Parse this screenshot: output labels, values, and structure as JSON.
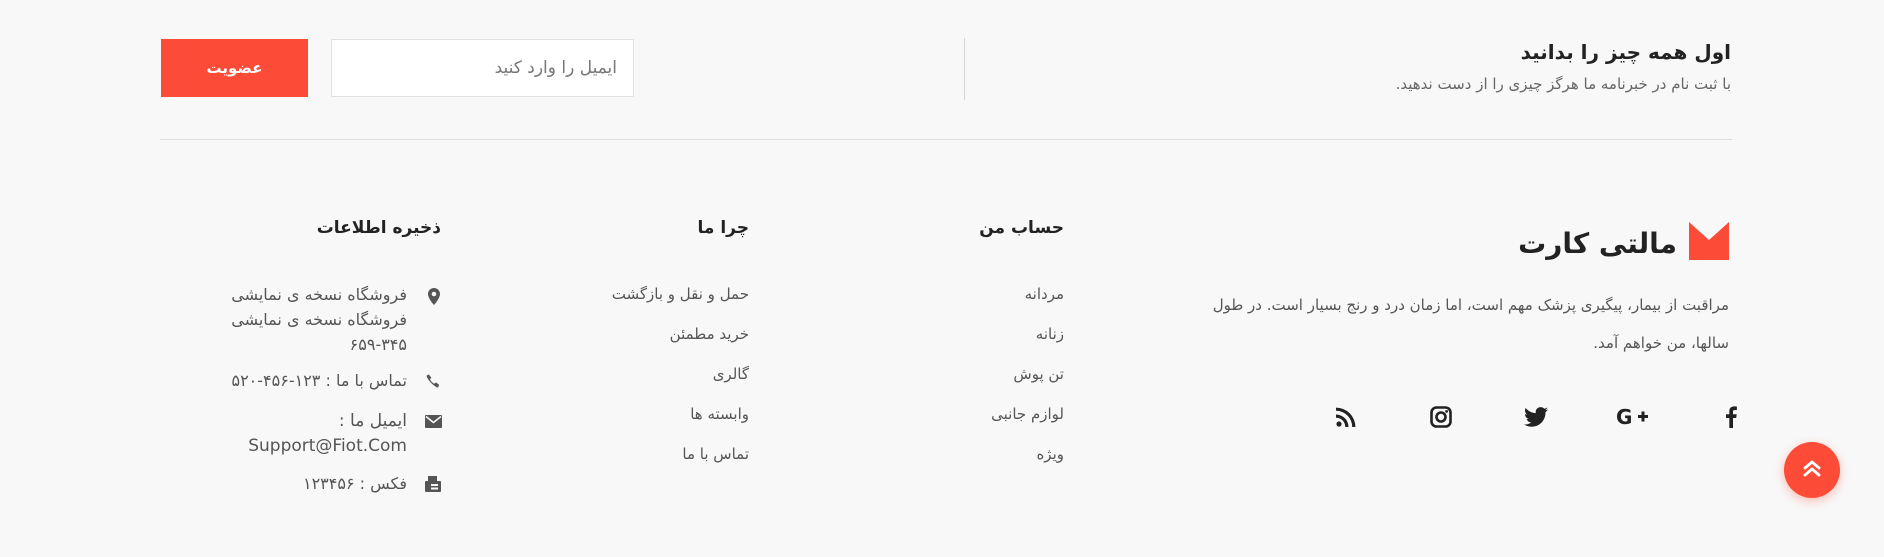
{
  "newsletter": {
    "title": "اول همه چیز را بدانید",
    "subtitle": "با ثبت نام در خبرنامه ما هرگز چیزی را از دست ندهید.",
    "email_placeholder": "ایمیل را وارد کنید",
    "subscribe_label": "عضویت"
  },
  "brand": {
    "name": "مالتی کارت",
    "description": "مراقبت از بیمار، پیگیری پزشک مهم است، اما زمان درد و رنج بسیار است. در طول سالها، من خواهم آمد.",
    "social": [
      {
        "icon": "facebook-icon"
      },
      {
        "icon": "google-plus-icon"
      },
      {
        "icon": "twitter-icon"
      },
      {
        "icon": "instagram-icon"
      },
      {
        "icon": "rss-icon"
      }
    ]
  },
  "account": {
    "title": "حساب من",
    "links": [
      "مردانه",
      "زنانه",
      "تن پوش",
      "لوازم جانبی",
      "ویژه"
    ]
  },
  "why": {
    "title": "چرا ما",
    "links": [
      "حمل و نقل و بازگشت",
      "خرید مطمئن",
      "گالری",
      "وابسته ها",
      "تماس با ما"
    ]
  },
  "info": {
    "title": "ذخیره اطلاعات",
    "address": [
      "فروشگاه نسخه ی نمایشی",
      "فروشگاه نسخه ی نمایشی",
      "۶۵۹-۳۴۵"
    ],
    "phone": "تماس با ما : ۱۲۳-۴۵۶-۵۲۰",
    "email_label": "ایمیل ما :",
    "email": "Support@Fiot.Com",
    "fax": "فکس : ۱۲۳۴۵۶"
  },
  "colors": {
    "accent": "#fc4c37",
    "background": "#f8f8f8",
    "text": "#555555"
  }
}
